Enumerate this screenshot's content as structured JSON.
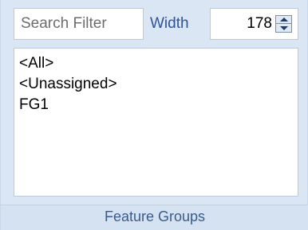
{
  "search": {
    "placeholder": "Search Filter"
  },
  "width_control": {
    "label": "Width",
    "value": "178"
  },
  "list": {
    "items": [
      "<All>",
      "<Unassigned>",
      "FG1"
    ]
  },
  "caption": "Feature Groups",
  "colors": {
    "panel_bg": "#dbe6f4",
    "label_blue": "#2f5496",
    "caption_blue": "#3b5b8c"
  },
  "icons": {
    "spinner_up": "triangle-up-icon",
    "spinner_down": "triangle-down-icon"
  }
}
